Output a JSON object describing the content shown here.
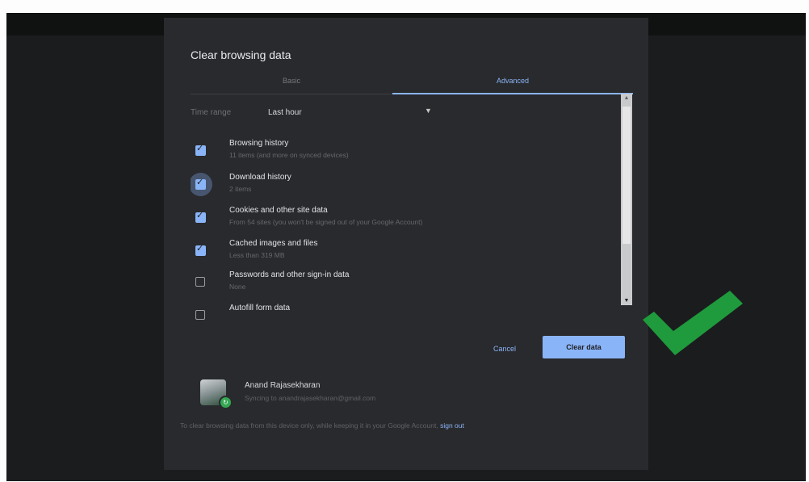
{
  "dialog": {
    "title": "Clear browsing data",
    "tabs": [
      {
        "label": "Basic",
        "selected": false
      },
      {
        "label": "Advanced",
        "selected": true
      }
    ],
    "time_range": {
      "label": "Time range",
      "value": "Last hour"
    },
    "items": [
      {
        "label": "Browsing history",
        "description": "11 items (and more on synced devices)",
        "checked": true
      },
      {
        "label": "Download history",
        "description": "2 items",
        "checked": true
      },
      {
        "label": "Cookies and other site data",
        "description": "From 54 sites (you won't be signed out of your Google Account)",
        "checked": true
      },
      {
        "label": "Cached images and files",
        "description": "Less than 319 MB",
        "checked": true
      },
      {
        "label": "Passwords and other sign-in data",
        "description": "None",
        "checked": false
      },
      {
        "label": "Autofill form data",
        "description": "",
        "checked": false
      }
    ],
    "buttons": {
      "cancel": "Cancel",
      "clear": "Clear data"
    },
    "account": {
      "name": "Anand Rajasekharan",
      "sync_text": "Syncing to anandrajasekharan@gmail.com"
    },
    "footer": {
      "text": "To clear browsing data from this device only, while keeping it in your Google Account,",
      "link": "sign out"
    }
  },
  "colors": {
    "accent": "#8ab4f8",
    "dialog_bg": "#292a2d",
    "checkmark": "#1f9a3c"
  }
}
